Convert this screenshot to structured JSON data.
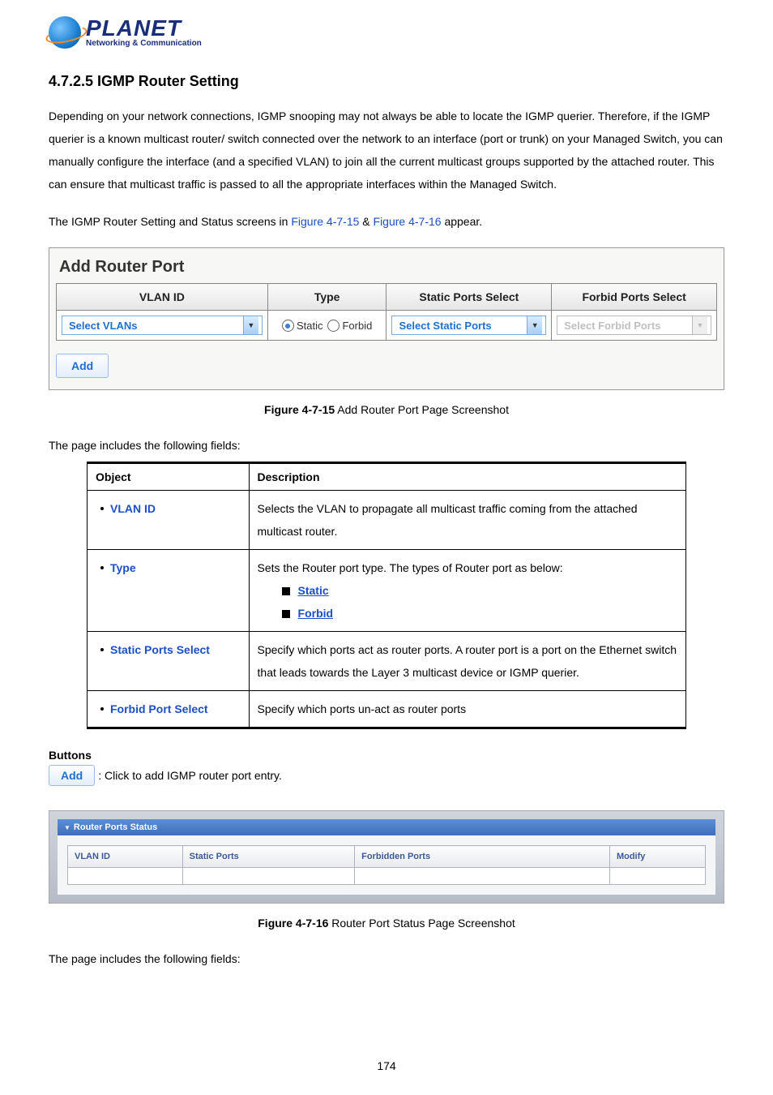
{
  "logo": {
    "brand": "PLANET",
    "tagline": "Networking & Communication"
  },
  "heading": "4.7.2.5 IGMP Router Setting",
  "intro": "Depending on your network connections, IGMP snooping may not always be able to locate the IGMP querier. Therefore, if the IGMP querier is a known multicast router/ switch connected over the network to an interface (port or trunk) on your Managed Switch, you can manually configure the interface (and a specified VLAN) to join all the current multicast groups supported by the attached router. This can ensure that multicast traffic is passed to all the appropriate interfaces within the Managed Switch.",
  "intro2_prefix": "The IGMP Router Setting and Status screens in ",
  "intro2_link1": "Figure 4-7-15",
  "intro2_amp": " & ",
  "intro2_link2": "Figure 4-7-16",
  "intro2_suffix": " appear.",
  "shot1": {
    "title": "Add Router Port",
    "headers": [
      "VLAN ID",
      "Type",
      "Static Ports Select",
      "Forbid Ports Select"
    ],
    "vlan_dd": "Select VLANs",
    "radio_static": "Static",
    "radio_forbid": "Forbid",
    "static_dd": "Select Static Ports",
    "forbid_dd": "Select Forbid Ports",
    "add_btn": "Add"
  },
  "caption1_b": "Figure 4-7-15",
  "caption1_t": " Add Router Port Page Screenshot",
  "fields_intro": "The page includes the following fields:",
  "fields_table": {
    "head_obj": "Object",
    "head_desc": "Description",
    "rows": [
      {
        "obj": "VLAN ID",
        "desc": "Selects the VLAN to propagate all multicast traffic coming from the attached multicast router."
      },
      {
        "obj": "Type",
        "desc_intro": "Sets the Router port type. The types of Router port as below:",
        "opts": [
          "Static",
          "Forbid"
        ]
      },
      {
        "obj": "Static Ports Select",
        "desc": "Specify which ports act as router ports. A router port is a port on the Ethernet switch that leads towards the Layer 3 multicast device or IGMP querier."
      },
      {
        "obj": "Forbid Port Select",
        "desc": "Specify which ports un-act as router ports"
      }
    ]
  },
  "buttons_label": "Buttons",
  "add_btn2": "Add",
  "add_btn2_desc": ": Click to add IGMP router port entry.",
  "shot2": {
    "bar": "Router Ports Status",
    "headers": [
      "VLAN ID",
      "Static Ports",
      "Forbidden Ports",
      "Modify"
    ]
  },
  "caption2_b": "Figure 4-7-16",
  "caption2_t": " Router Port Status Page Screenshot",
  "fields_intro2": "The page includes the following fields:",
  "page_number": "174"
}
